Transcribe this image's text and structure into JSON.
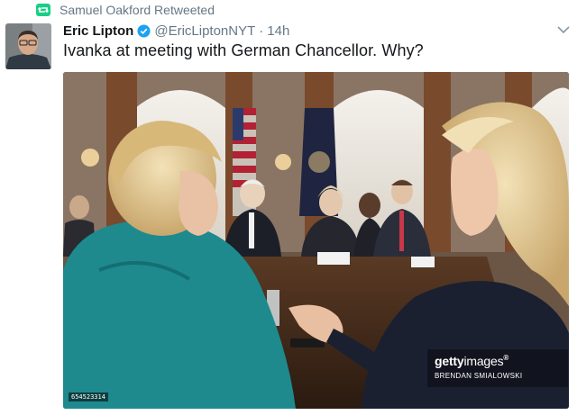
{
  "retweet": {
    "label": "Samuel Oakford Retweeted",
    "icon": "retweet-icon",
    "icon_color": "#19cf86"
  },
  "tweet": {
    "author_name": "Eric Lipton",
    "verified_icon": "verified-badge-icon",
    "verified_color": "#1da1f2",
    "handle": "@EricLiptonNYT",
    "separator": "·",
    "timestamp": "14h",
    "text": "Ivanka at meeting with German Chancellor. Why?",
    "menu_icon": "chevron-down-icon"
  },
  "media": {
    "watermark_brand_bold": "getty",
    "watermark_brand_light": "images",
    "watermark_registered": "®",
    "watermark_credit": "BRENDAN SMIALOWSKI",
    "image_id": "654523314"
  },
  "colors": {
    "text_primary": "#14171a",
    "text_secondary": "#657786",
    "background": "#ffffff"
  }
}
